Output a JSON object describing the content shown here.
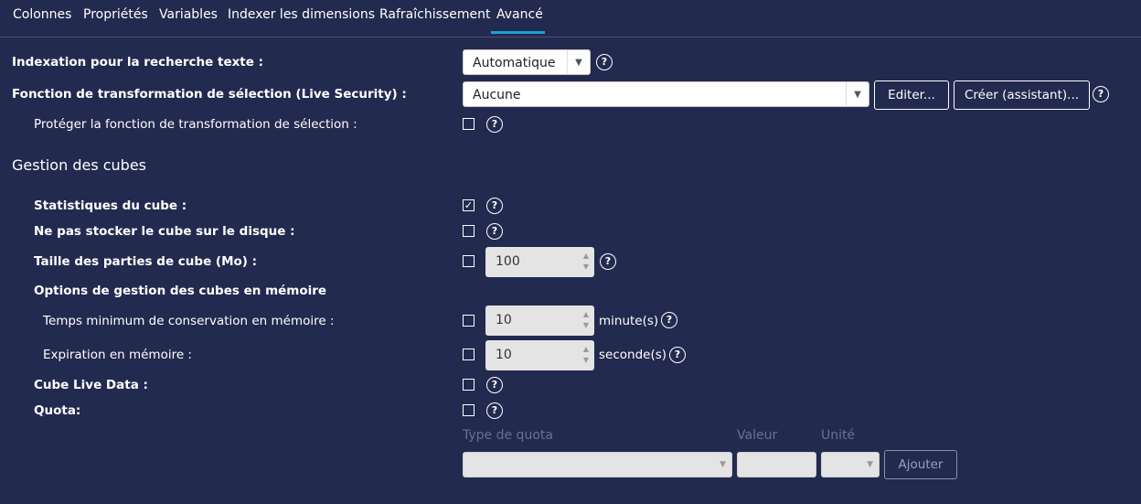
{
  "tabs": [
    {
      "label": "Colonnes"
    },
    {
      "label": "Propriétés"
    },
    {
      "label": "Variables"
    },
    {
      "label": "Indexer les dimensions"
    },
    {
      "label": "Rafraîchissement"
    },
    {
      "label": "Avancé",
      "active": true
    }
  ],
  "text_index": {
    "label": "Indexation pour la recherche texte :",
    "value": "Automatique"
  },
  "transform": {
    "label": "Fonction de transformation de sélection (Live Security) :",
    "value": "Aucune",
    "edit_label": "Editer...",
    "create_label": "Créer (assistant)..."
  },
  "protect": {
    "label": "Protéger la fonction de transformation de sélection :",
    "checked": false
  },
  "cubes": {
    "title": "Gestion des cubes",
    "stats": {
      "label": "Statistiques du cube :",
      "checked": true
    },
    "no_store": {
      "label": "Ne pas stocker le cube sur le disque :",
      "checked": false
    },
    "part_size": {
      "label": "Taille des parties de cube (Mo) :",
      "checked": false,
      "value": "100"
    },
    "memory_options": {
      "label": "Options de gestion des cubes en mémoire"
    },
    "min_time": {
      "label": "Temps minimum de conservation en mémoire :",
      "checked": false,
      "value": "10",
      "unit": "minute(s)"
    },
    "expiration": {
      "label": "Expiration en mémoire :",
      "checked": false,
      "value": "10",
      "unit": "seconde(s)"
    },
    "live_data": {
      "label": "Cube Live Data :",
      "checked": false
    },
    "quota": {
      "label": "Quota:",
      "checked": false,
      "type_label": "Type de quota",
      "value_label": "Valeur",
      "unit_label": "Unité",
      "add_label": "Ajouter"
    }
  },
  "help_glyph": "?",
  "check_glyph": "✓",
  "arrow_glyph": "▼",
  "colors": {
    "background": "#232a4f",
    "accent": "#1f9fd6"
  }
}
